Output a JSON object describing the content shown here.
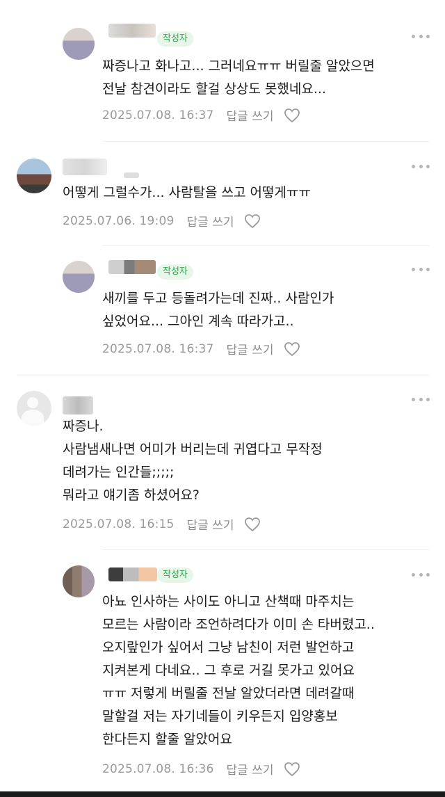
{
  "author_badge": "작성자",
  "reply_label": "답글 쓰기",
  "icons": {
    "more": "more-dots-icon",
    "like": "heart-icon"
  },
  "comments": [
    {
      "text": "짜증나고 화나고... 그러네요ㅠㅠ 버릴줄 알았으면\n전날 참견이라도 할걸 상상도 못했네요...",
      "date": "2025.07.08. 16:37"
    },
    {
      "text": "어떻게 그럴수가... 사람탈을 쓰고 어떻게ㅠㅠ",
      "date": "2025.07.06. 19:09"
    },
    {
      "text": "새끼를 두고 등돌려가는데 진짜.. 사람인가\n싶었어요... 그아인 계속 따라가고..",
      "date": "2025.07.08. 16:37"
    },
    {
      "text": "짜증나.\n사람냄새나면 어미가 버리는데 귀엽다고 무작정\n데려가는 인간들;;;;;\n뭐라고 얘기좀 하셨어요?",
      "date": "2025.07.08. 16:15"
    },
    {
      "text": "아뇨 인사하는 사이도 아니고 산책때 마주치는\n모르는 사람이라 조언하려다가 이미 손 타버렸고..\n오지랖인가 싶어서 그냥 남친이 저런 발언하고\n지켜본게 다네요.. 그 후로 거길 못가고 있어요\nㅠㅠ 저렇게 버릴줄 전날 알았더라면 데려갈때\n말할걸 저는 자기네들이 키우든지 입양홍보\n한다든지 할줄 알았어요",
      "date": "2025.07.08. 16:36"
    }
  ]
}
